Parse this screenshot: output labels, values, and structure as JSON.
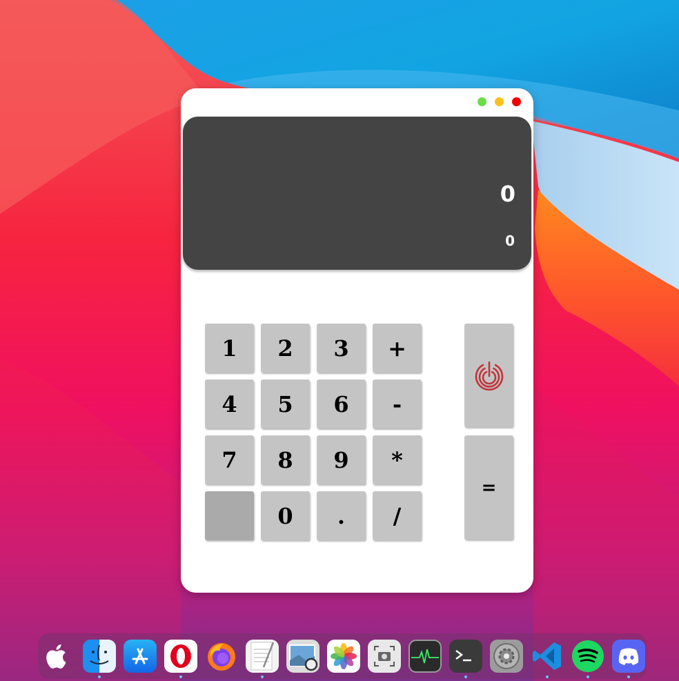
{
  "window": {
    "controls": [
      {
        "name": "zoom-button",
        "color": "#6cdc4a"
      },
      {
        "name": "minimize-button",
        "color": "#f9c11c"
      },
      {
        "name": "close-button",
        "color": "#f00000"
      }
    ]
  },
  "display": {
    "main_value": "0",
    "sub_value": "0",
    "background": "#444444"
  },
  "keypad": {
    "rows": [
      [
        "1",
        "2",
        "3",
        "+"
      ],
      [
        "4",
        "5",
        "6",
        "-"
      ],
      [
        "7",
        "8",
        "9",
        "*"
      ],
      [
        "",
        "0",
        ".",
        "/"
      ]
    ],
    "power_icon": "power-icon",
    "power_color": "#c0353b",
    "equals_label": "=",
    "key_color": "#c4c4c4",
    "blank_key_color": "#aaaaaa"
  },
  "dock": {
    "apps": [
      {
        "name": "apple",
        "icon": "apple-logo-icon",
        "running": false
      },
      {
        "name": "finder",
        "icon": "finder-icon",
        "running": true
      },
      {
        "name": "app-store",
        "icon": "app-store-icon",
        "running": false
      },
      {
        "name": "opera",
        "icon": "opera-icon",
        "running": true
      },
      {
        "name": "firefox",
        "icon": "firefox-icon",
        "running": false
      },
      {
        "name": "textedit",
        "icon": "textedit-icon",
        "running": true
      },
      {
        "name": "preview",
        "icon": "preview-icon",
        "running": false
      },
      {
        "name": "photos",
        "icon": "photos-icon",
        "running": false
      },
      {
        "name": "screenshot",
        "icon": "screenshot-icon",
        "running": false
      },
      {
        "name": "activity-monitor",
        "icon": "activity-monitor-icon",
        "running": false
      },
      {
        "name": "terminal",
        "icon": "terminal-icon",
        "running": true
      },
      {
        "name": "system-preferences",
        "icon": "system-preferences-icon",
        "running": false
      },
      {
        "name": "vscode",
        "icon": "vscode-icon",
        "running": true
      },
      {
        "name": "spotify",
        "icon": "spotify-icon",
        "running": true
      },
      {
        "name": "discord",
        "icon": "discord-icon",
        "running": true
      }
    ]
  }
}
